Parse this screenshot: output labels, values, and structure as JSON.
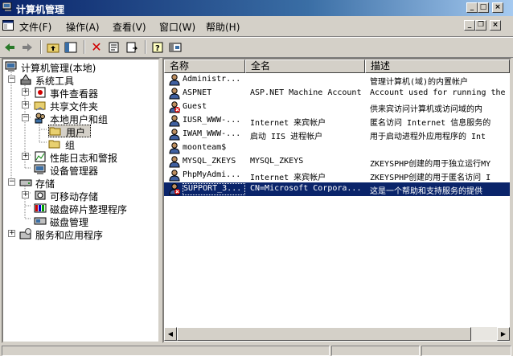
{
  "window": {
    "title": "计算机管理",
    "minimize_glyph": "_",
    "maximize_glyph": "□",
    "close_glyph": "×",
    "restore_glyph": "❐"
  },
  "menu": [
    "文件(F)",
    "操作(A)",
    "查看(V)",
    "窗口(W)",
    "帮助(H)"
  ],
  "toolbar": {
    "icons": [
      "back-arrow-icon",
      "forward-arrow-icon",
      "up-folder-icon",
      "show-hide-tree-icon",
      "delete-icon",
      "properties-icon",
      "export-list-icon",
      "help-icon",
      "console-icon"
    ]
  },
  "tree": {
    "root": "计算机管理(本地)",
    "system_tools": "系统工具",
    "event_viewer": "事件查看器",
    "shared_folders": "共享文件夹",
    "local_users": "本地用户和组",
    "users": "用户",
    "groups": "组",
    "perf_logs": "性能日志和警报",
    "device_manager": "设备管理器",
    "storage": "存储",
    "removable_storage": "可移动存储",
    "defrag": "磁盘碎片整理程序",
    "disk_management": "磁盘管理",
    "services_apps": "服务和应用程序"
  },
  "list": {
    "columns": [
      "名称",
      "全名",
      "描述"
    ],
    "rows": [
      {
        "name": "Administr...",
        "fullname": "",
        "desc": "管理计算机(域)的内置帐户",
        "disabled": false,
        "selected": false
      },
      {
        "name": "ASPNET",
        "fullname": "ASP.NET Machine Account",
        "desc": "Account used for running the",
        "disabled": false,
        "selected": false
      },
      {
        "name": "Guest",
        "fullname": "",
        "desc": "供来宾访问计算机或访问域的内",
        "disabled": true,
        "selected": false
      },
      {
        "name": "IUSR_WWW-...",
        "fullname": "Internet 来宾帐户",
        "desc": "匿名访问 Internet 信息服务的",
        "disabled": false,
        "selected": false
      },
      {
        "name": "IWAM_WWW-...",
        "fullname": "启动 IIS 进程帐户",
        "desc": "用于启动进程外应用程序的 Int",
        "disabled": false,
        "selected": false
      },
      {
        "name": "moonteam$",
        "fullname": "",
        "desc": "",
        "disabled": false,
        "selected": false
      },
      {
        "name": "MYSQL_ZKEYS",
        "fullname": "MYSQL_ZKEYS",
        "desc": "ZKEYSPHP创建的用于独立运行MY",
        "disabled": false,
        "selected": false
      },
      {
        "name": "PhpMyAdmi...",
        "fullname": "Internet 来宾帐户",
        "desc": "ZKEYSPHP创建的用于匿名访问 I",
        "disabled": false,
        "selected": false
      },
      {
        "name": "SUPPORT_3...",
        "fullname": "CN=Microsoft Corpora...",
        "desc": "这是一个帮助和支持服务的提供",
        "disabled": true,
        "selected": true
      }
    ]
  },
  "scroll": {
    "left_glyph": "◀",
    "right_glyph": "▶",
    "position": 0.0
  },
  "colors": {
    "selection": "#0a246a",
    "titlebar": "#0a246a",
    "face": "#d4d0c8"
  }
}
